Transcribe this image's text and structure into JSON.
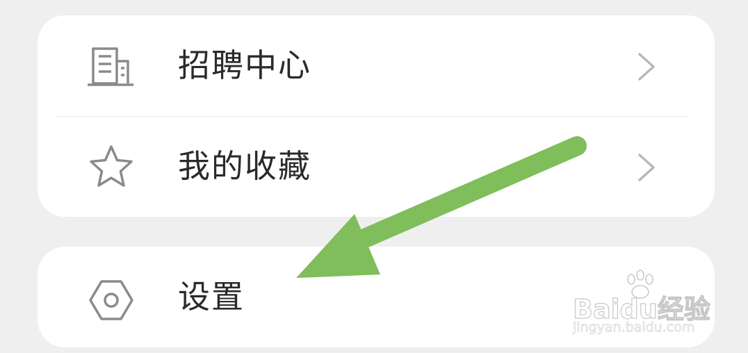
{
  "menu_group_1": {
    "items": [
      {
        "label": "招聘中心",
        "icon": "building-icon"
      },
      {
        "label": "我的收藏",
        "icon": "star-icon"
      }
    ]
  },
  "menu_group_2": {
    "items": [
      {
        "label": "设置",
        "icon": "settings-hexagon-icon"
      }
    ]
  },
  "annotation": {
    "arrow_color": "#7fbe5a"
  },
  "watermark": {
    "brand": "Baidu经验",
    "url": "jingyan.baidu.com"
  }
}
